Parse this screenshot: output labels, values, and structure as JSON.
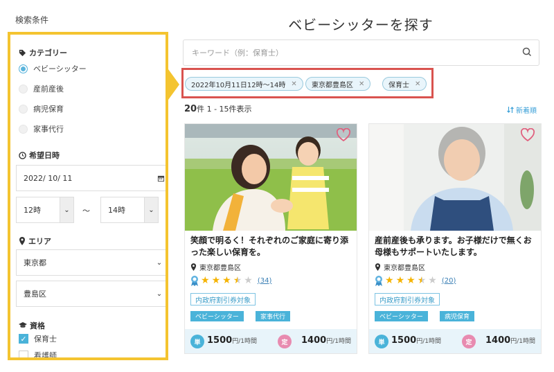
{
  "sidebar": {
    "title": "検索条件",
    "category": {
      "heading": "カテゴリー",
      "options": [
        "ベビーシッター",
        "産前産後",
        "病児保育",
        "家事代行"
      ],
      "selected": 0
    },
    "datetime": {
      "heading": "希望日時",
      "date": "2022/ 10/ 11",
      "start": "12時",
      "separator": "〜",
      "end": "14時"
    },
    "area": {
      "heading": "エリア",
      "prefecture": "東京都",
      "city": "豊島区"
    },
    "qualification": {
      "heading": "資格",
      "options": [
        {
          "label": "保育士",
          "checked": true
        },
        {
          "label": "看護師",
          "checked": false
        }
      ]
    }
  },
  "main": {
    "title": "ベビーシッターを探す",
    "search_placeholder": "キーワード（例：保育士）",
    "chips": [
      "2022年10月11日12時〜14時",
      "東京都豊島区",
      "保育士"
    ],
    "count_number": "20",
    "count_unit": "件",
    "count_range": "1 - 15件表示",
    "sort_label": "新着順"
  },
  "cards": [
    {
      "title": "笑顔で明るく！それぞれのご家庭に寄り添った楽しい保育を。",
      "location": "東京都豊島区",
      "rating": 3.5,
      "reviews": "(34)",
      "badge": "内政府割引券対象",
      "tags": [
        "ベビーシッター",
        "家事代行"
      ],
      "price1_label": "単",
      "price1": "1500",
      "price2_label": "定",
      "price2": "1400",
      "price_unit": "円/1時間"
    },
    {
      "title": "産前産後も承ります。お子様だけで無くお母様もサポートいたします。",
      "location": "東京都豊島区",
      "rating": 3.5,
      "reviews": "(20)",
      "badge": "内政府割引券対象",
      "tags": [
        "ベビーシッター",
        "病児保育"
      ],
      "price1_label": "単",
      "price1": "1500",
      "price2_label": "定",
      "price2": "1400",
      "price_unit": "円/1時間"
    }
  ],
  "colors": {
    "highlight_yellow": "#f4c430",
    "highlight_red": "#d9534f",
    "accent_blue": "#4ab3d9",
    "price_pink": "#e88bb0"
  }
}
